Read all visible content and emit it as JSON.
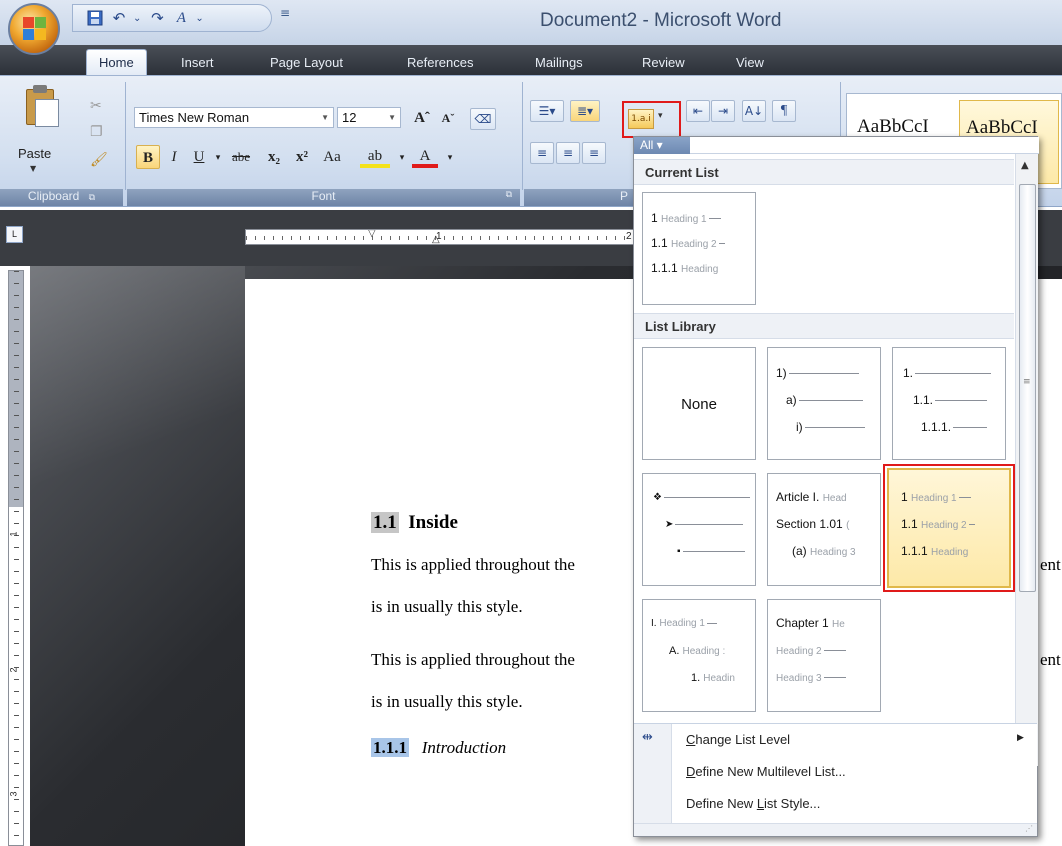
{
  "window": {
    "title": "Document2 - Microsoft Word"
  },
  "qat": {
    "more_label": "≡"
  },
  "tabs": [
    "Home",
    "Insert",
    "Page Layout",
    "References",
    "Mailings",
    "Review",
    "View"
  ],
  "ribbon": {
    "clipboard": {
      "paste_label": "Paste",
      "group_label": "Clipboard"
    },
    "font": {
      "font_name": "Times New Roman",
      "font_size": "12",
      "group_label": "Font",
      "bold": "B",
      "italic": "I",
      "underline": "U",
      "strike": "abe",
      "subscript": "x₂",
      "superscript": "x²",
      "change_case": "Aa",
      "grow": "Aˆ",
      "shrink": "Aˇ"
    },
    "paragraph": {
      "group_label": "P",
      "pilcrow": "¶",
      "sort": "A↓"
    },
    "styles": {
      "item1": "AaBbCcI",
      "item2": "AaBbCcI"
    }
  },
  "colors": {
    "highlight_red": "#e01a1a",
    "ribbon_blue": "#d4e0f0",
    "selection_gold": "#fde9a8"
  },
  "ruler": {
    "h_nums": [
      "1",
      "2"
    ],
    "v_nums": [
      "1",
      "2",
      "3"
    ]
  },
  "document": {
    "heading1_num": "1.1",
    "heading1_text": "Inside",
    "para1_line1": "This is applied throughout the",
    "para1_line1_right": "ent",
    "para1_line2": "is in usually this style.",
    "para2_line1": "This is applied throughout the",
    "para2_line1_right": "ent",
    "para2_line2": "is in usually this style.",
    "heading2_num": "1.1.1",
    "heading2_text": "Introduction"
  },
  "dropdown": {
    "filter_label": "All ▾",
    "current_list_label": "Current List",
    "list_library_label": "List Library",
    "current": {
      "l1": "1",
      "l1t": "Heading 1",
      "l2": "1.1",
      "l2t": "Heading 2",
      "l3": "1.1.1",
      "l3t": "Heading"
    },
    "none_label": "None",
    "lib_num": {
      "l1": "1)",
      "l2": "a)",
      "l3": "i)"
    },
    "lib_dec": {
      "l1": "1.",
      "l2": "1.1.",
      "l3": "1.1.1."
    },
    "lib_bullets": {
      "l1": "❖",
      "l2": "➤",
      "l3": "▪"
    },
    "lib_article": {
      "l1": "Article I.",
      "l1t": "Head",
      "l2": "Section 1.01",
      "l2t": "(",
      "l3": "(a)",
      "l3t": "Heading 3"
    },
    "lib_heading_sel": {
      "l1": "1",
      "l1t": "Heading 1",
      "l2": "1.1",
      "l2t": "Heading 2",
      "l3": "1.1.1",
      "l3t": "Heading"
    },
    "lib_roman": {
      "l1": "I.",
      "l1t": "Heading 1",
      "l2": "A.",
      "l2t": "Heading :",
      "l3": "1.",
      "l3t": "Headin"
    },
    "lib_chapter": {
      "l1": "Chapter 1",
      "l1t": "He",
      "l2t": "Heading 2",
      "l3t": "Heading 3"
    },
    "menu": {
      "change_level_u": "C",
      "change_level_rest": "hange List Level",
      "define_multilevel_u": "D",
      "define_multilevel_rest": "efine New Multilevel List...",
      "define_style_pre": "Define New ",
      "define_style_u": "L",
      "define_style_rest": "ist Style..."
    }
  }
}
